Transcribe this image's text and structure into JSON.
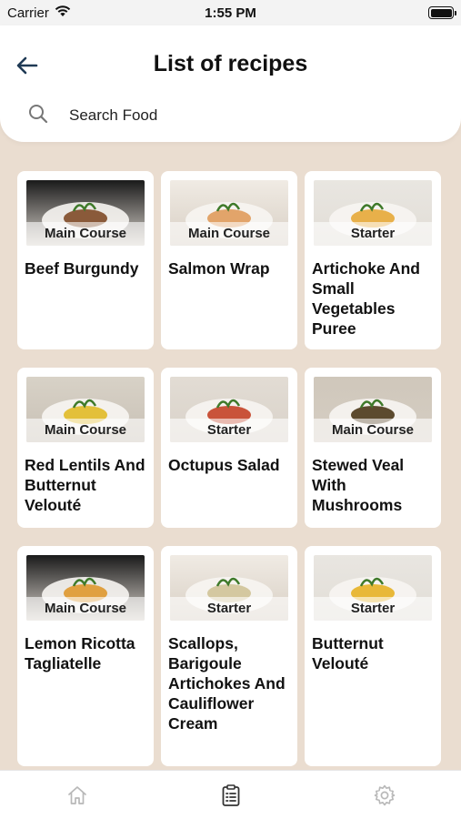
{
  "status_bar": {
    "carrier": "Carrier",
    "time": "1:55 PM"
  },
  "header": {
    "title": "List of recipes",
    "search_placeholder": "Search Food"
  },
  "recipes": [
    {
      "title": "Beef Burgundy",
      "category": "Main Course"
    },
    {
      "title": "Salmon Wrap",
      "category": "Main Course"
    },
    {
      "title": "Artichoke And Small Vegetables Puree",
      "category": "Starter"
    },
    {
      "title": "Red Lentils And Butternut Velouté",
      "category": "Main Course"
    },
    {
      "title": "Octupus Salad",
      "category": "Starter"
    },
    {
      "title": "Stewed Veal With Mushrooms",
      "category": "Main Course"
    },
    {
      "title": "Lemon Ricotta Tagliatelle",
      "category": "Main Course"
    },
    {
      "title": "Scallops, Barigoule Artichokes And Cauliflower Cream",
      "category": "Starter"
    },
    {
      "title": "Butternut Velouté",
      "category": "Starter"
    }
  ],
  "tabs": [
    {
      "icon": "home-icon",
      "active": false
    },
    {
      "icon": "clipboard-list-icon",
      "active": true
    },
    {
      "icon": "gear-icon",
      "active": false
    }
  ],
  "colors": {
    "background": "#eaddd0",
    "card": "#ffffff",
    "back_arrow": "#1f3a55"
  }
}
